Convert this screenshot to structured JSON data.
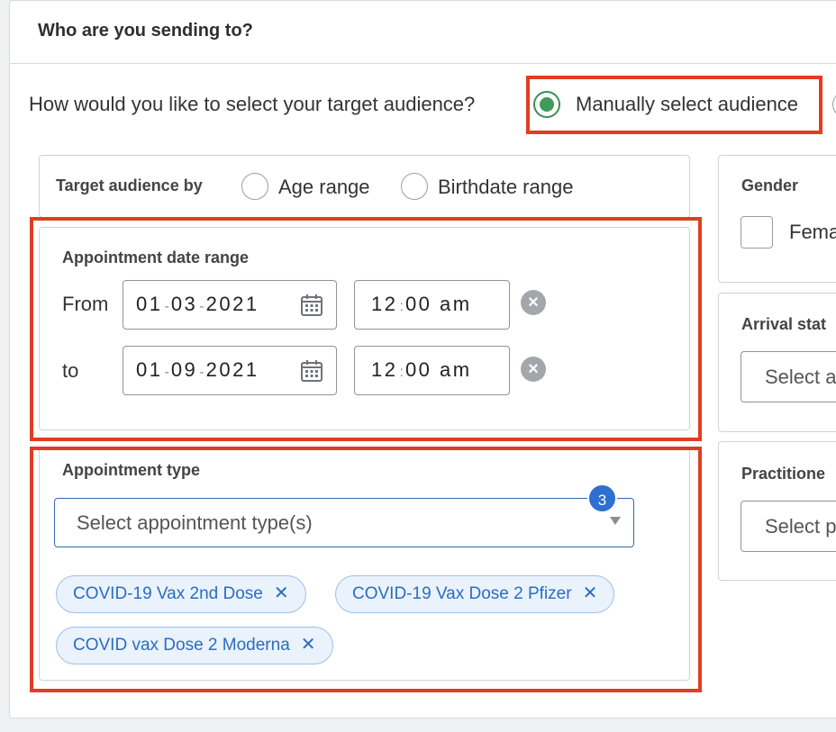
{
  "header": {
    "title": "Who are you sending to?"
  },
  "selection": {
    "question": "How would you like to select your target audience?",
    "options": [
      {
        "label": "Manually select audience",
        "selected": true
      }
    ]
  },
  "target_by": {
    "label": "Target audience by",
    "options": [
      {
        "label": "Age range"
      },
      {
        "label": "Birthdate range"
      }
    ]
  },
  "appointment_date_range": {
    "title": "Appointment date range",
    "from": {
      "label": "From",
      "date": [
        "01",
        "03",
        "2021"
      ],
      "time": [
        "12",
        "00",
        "am"
      ]
    },
    "to": {
      "label": "to",
      "date": [
        "01",
        "09",
        "2021"
      ],
      "time": [
        "12",
        "00",
        "am"
      ]
    }
  },
  "appointment_type": {
    "title": "Appointment type",
    "placeholder": "Select appointment type(s)",
    "count": "3",
    "chips": [
      "COVID-19 Vax 2nd Dose",
      "COVID-19 Vax Dose 2 Pfizer",
      "COVID vax Dose 2 Moderna"
    ]
  },
  "gender": {
    "title": "Gender",
    "options": [
      {
        "label": "Fema"
      }
    ]
  },
  "arrival_status": {
    "title": "Arrival stat",
    "placeholder": "Select a"
  },
  "practitioner": {
    "title": "Practitione",
    "placeholder": "Select p"
  },
  "colors": {
    "highlight": "#e03e22",
    "accent": "#2f6fd0",
    "selected_radio": "#3f9a5c",
    "chip_text": "#2a6dc0"
  },
  "icons": {
    "calendar": "calendar-icon",
    "clear": "clear-icon",
    "remove": "remove-chip-icon",
    "dropdown": "chevron-down-icon"
  }
}
